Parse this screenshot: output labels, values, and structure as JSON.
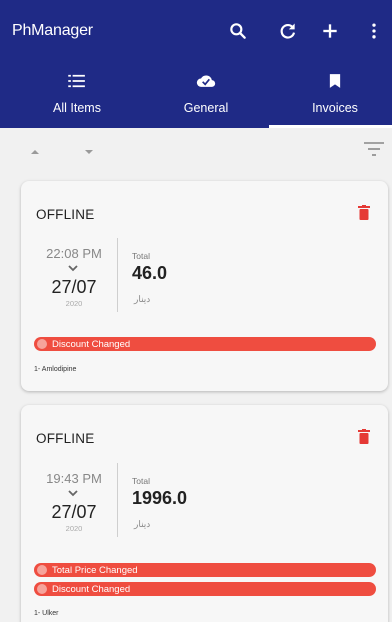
{
  "app": {
    "title": "PhManager"
  },
  "header_actions": [
    {
      "name": "search",
      "icon": "search-icon"
    },
    {
      "name": "refresh",
      "icon": "refresh-icon"
    },
    {
      "name": "add",
      "icon": "plus-icon"
    },
    {
      "name": "overflow-menu",
      "icon": "more-vert-icon"
    }
  ],
  "tabs": [
    {
      "label": "All Items",
      "icon": "list-icon"
    },
    {
      "label": "General",
      "icon": "cloud-check-icon"
    },
    {
      "label": "Invoices",
      "icon": "bookmark-icon",
      "selected": true
    }
  ],
  "sort": {
    "up_icon": "sort-up-icon",
    "down_icon": "sort-down-icon",
    "filter_icon": "filter-icon"
  },
  "invoices": [
    {
      "status": "OFFLINE",
      "time": "22:08 PM",
      "date": "27/07",
      "year": "2020",
      "total_label": "Total",
      "total": "46.0",
      "currency": "دينار",
      "changes": [
        "Discount Changed"
      ],
      "items": "1- Amlodipine"
    },
    {
      "status": "OFFLINE",
      "time": "19:43 PM",
      "date": "27/07",
      "year": "2020",
      "total_label": "Total",
      "total": "1996.0",
      "currency": "دينار",
      "changes": [
        "Total Price Changed",
        "Discount Changed"
      ],
      "items": "1- Ulker"
    }
  ],
  "colors": {
    "appbar": "#1f2a86",
    "background": "#f1f1f1",
    "card": "#f7f7f7",
    "chip": "#ef4d40",
    "trash": "#e53935"
  }
}
